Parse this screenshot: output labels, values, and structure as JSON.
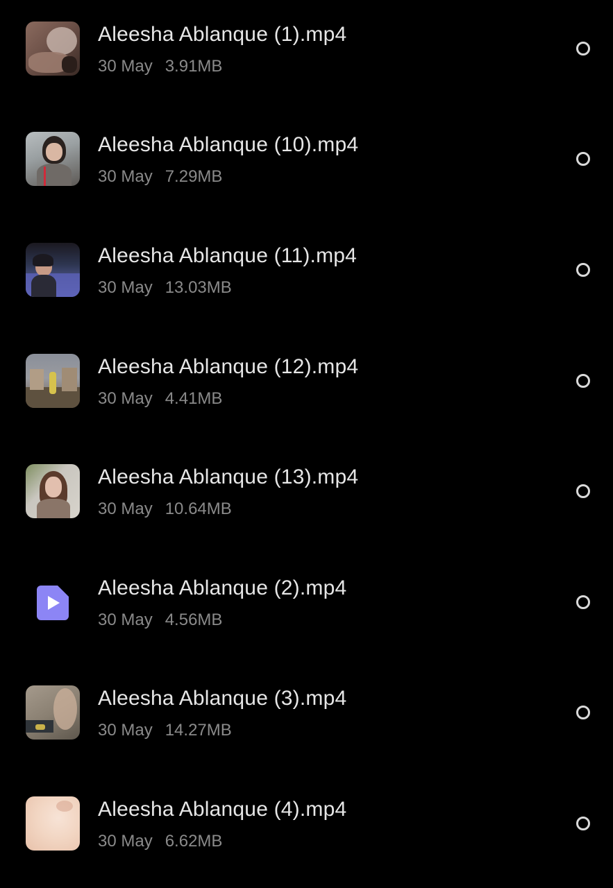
{
  "files": [
    {
      "name": "Aleesha Ablanque (1).mp4",
      "date": "30 May",
      "size": "3.91MB",
      "thumbnail": "photo",
      "colors": [
        "#6d5148",
        "#9b7b6e",
        "#c9b7ae",
        "#3a2a25"
      ]
    },
    {
      "name": "Aleesha Ablanque (10).mp4",
      "date": "30 May",
      "size": "7.29MB",
      "thumbnail": "photo",
      "colors": [
        "#9aa0a2",
        "#6f6a66",
        "#2a221f",
        "#d9b7a3"
      ]
    },
    {
      "name": "Aleesha Ablanque (11).mp4",
      "date": "30 May",
      "size": "13.03MB",
      "thumbnail": "photo",
      "colors": [
        "#2d3550",
        "#6e74c6",
        "#1b1920",
        "#c79a86"
      ]
    },
    {
      "name": "Aleesha Ablanque (12).mp4",
      "date": "30 May",
      "size": "4.41MB",
      "thumbnail": "photo",
      "colors": [
        "#8a8f99",
        "#b19d86",
        "#6b5b48",
        "#d6c24d"
      ]
    },
    {
      "name": "Aleesha Ablanque (13).mp4",
      "date": "30 May",
      "size": "10.64MB",
      "thumbnail": "photo",
      "colors": [
        "#c9c6bf",
        "#7f8f61",
        "#5b3b2c",
        "#e2bfae"
      ]
    },
    {
      "name": "Aleesha Ablanque (2).mp4",
      "date": "30 May",
      "size": "4.56MB",
      "thumbnail": "video-file-icon",
      "colors": [
        "#8c85f5",
        "#ffffff"
      ]
    },
    {
      "name": "Aleesha Ablanque (3).mp4",
      "date": "30 May",
      "size": "14.27MB",
      "thumbnail": "photo",
      "colors": [
        "#a59a8c",
        "#7e7466",
        "#c8ae99",
        "#2f3439"
      ]
    },
    {
      "name": "Aleesha Ablanque (4).mp4",
      "date": "30 May",
      "size": "6.62MB",
      "thumbnail": "photo",
      "colors": [
        "#f2d6c3",
        "#e8c2ab",
        "#f7e3d6",
        "#d9a893"
      ]
    }
  ]
}
